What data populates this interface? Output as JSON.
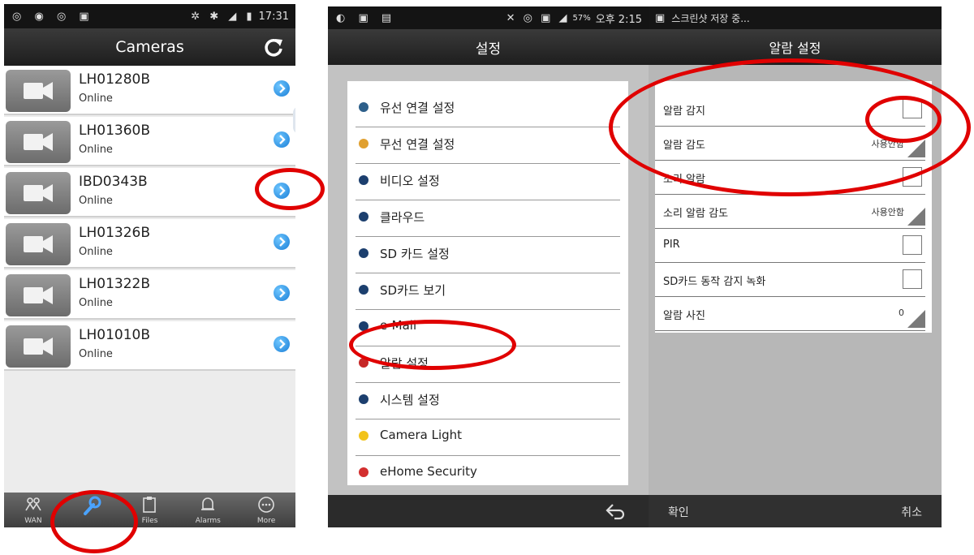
{
  "panel1": {
    "status_time": "17:31",
    "title": "Cameras",
    "cameras": [
      {
        "name": "LH01280B",
        "status": "Online"
      },
      {
        "name": "LH01360B",
        "status": "Online"
      },
      {
        "name": "IBD0343B",
        "status": "Online"
      },
      {
        "name": "LH01326B",
        "status": "Online"
      },
      {
        "name": "LH01322B",
        "status": "Online"
      },
      {
        "name": "LH01010B",
        "status": "Online"
      }
    ],
    "tabs": [
      {
        "label": "WAN",
        "icon": "wan-icon"
      },
      {
        "label": "",
        "icon": "wrench-icon"
      },
      {
        "label": "Files",
        "icon": "clipboard-icon"
      },
      {
        "label": "Alarms",
        "icon": "bell-icon"
      },
      {
        "label": "More",
        "icon": "more-icon"
      }
    ]
  },
  "panel2": {
    "status_battery": "57%",
    "status_time": "오후 2:15",
    "title": "설정",
    "menu": [
      {
        "label": "유선 연결 설정",
        "icon": "wired-icon",
        "color": "#2d5f8a"
      },
      {
        "label": "무선 연결 설정",
        "icon": "wireless-icon",
        "color": "#e0a030"
      },
      {
        "label": "비디오 설정",
        "icon": "video-icon",
        "color": "#1c3f6e"
      },
      {
        "label": "클라우드",
        "icon": "cloud-icon",
        "color": "#1c3f6e"
      },
      {
        "label": "SD 카드 설정",
        "icon": "sd-card-icon",
        "color": "#1c3f6e"
      },
      {
        "label": "SD카드 보기",
        "icon": "sd-view-icon",
        "color": "#1c3f6e"
      },
      {
        "label": "e-Mail",
        "icon": "mail-icon",
        "color": "#1c3f6e"
      },
      {
        "label": "알람 설정",
        "icon": "alarm-icon",
        "color": "#c62828"
      },
      {
        "label": "시스템 설정",
        "icon": "info-icon",
        "color": "#1c3f6e"
      },
      {
        "label": "Camera Light",
        "icon": "lightbulb-icon",
        "color": "#f2c31a"
      },
      {
        "label": "eHome Security",
        "icon": "security-icon",
        "color": "#d32f2f"
      }
    ]
  },
  "panel3": {
    "status_text": "스크린샷 저장 중...",
    "title": "알람 설정",
    "settings": [
      {
        "label": "알람 감지",
        "type": "checkbox",
        "value": ""
      },
      {
        "label": "알람 감도",
        "type": "select",
        "value": "사용안함"
      },
      {
        "label": "소리 알람",
        "type": "checkbox",
        "value": ""
      },
      {
        "label": "소리 알람 감도",
        "type": "select",
        "value": "사용안함"
      },
      {
        "label": "PIR",
        "type": "checkbox",
        "value": ""
      },
      {
        "label": "SD카드 동작 감지 녹화",
        "type": "checkbox",
        "value": ""
      },
      {
        "label": "알람 사진",
        "type": "select",
        "value": "0"
      }
    ],
    "ok_label": "확인",
    "cancel_label": "취소"
  },
  "accent_color": "#e00000"
}
